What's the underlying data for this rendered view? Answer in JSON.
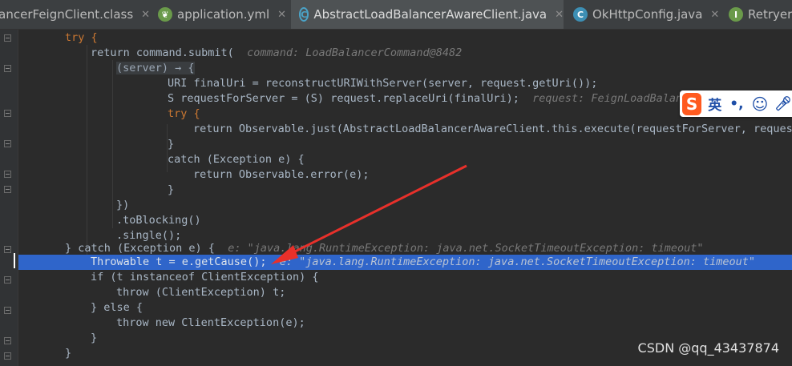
{
  "tabs": [
    {
      "label": "lancerFeignClient.class",
      "icon": "class-file-icon",
      "active": false
    },
    {
      "label": "application.yml",
      "icon": "spring-leaf-icon",
      "active": false
    },
    {
      "label": "AbstractLoadBalancerAwareClient.java",
      "icon": "abstract-class-icon",
      "active": true
    },
    {
      "label": "OkHttpConfig.java",
      "icon": "class-icon",
      "active": false
    },
    {
      "label": "Retryer",
      "icon": "interface-icon",
      "active": false
    }
  ],
  "code_lines": [
    [
      "try {"
    ],
    [
      "return command.submit(",
      "command: LoadBalancerCommand@8482"
    ],
    [
      "(server) → {"
    ],
    [
      "URI finalUri = reconstructURIWithServer(server, request.getUri());"
    ],
    [
      "S requestForServer = (S) request.replaceUri(finalUri);",
      "request: FeignLoadBalanc"
    ],
    [
      "try {"
    ],
    [
      "return Observable.just(AbstractLoadBalancerAwareClient.this.execute(requestForServer, request("
    ],
    [
      "}"
    ],
    [
      "catch (Exception e) {"
    ],
    [
      "return Observable.error(e);"
    ],
    [
      "}"
    ],
    [
      "})"
    ],
    [
      ".toBlocking()"
    ],
    [
      ".single();"
    ],
    [
      "} catch (Exception e) {",
      "e: \"java.lang.RuntimeException: java.net.SocketTimeoutException: timeout\""
    ],
    [
      "Throwable t = e.getCause();",
      "e: \"java.lang.RuntimeException: java.net.SocketTimeoutException: timeout\""
    ],
    [
      "if (t instanceof ClientException) {"
    ],
    [
      "throw (ClientException) t;"
    ],
    [
      "} else {"
    ],
    [
      "throw new ClientException(e);"
    ],
    [
      "}"
    ],
    [
      "}"
    ]
  ],
  "ime": {
    "logo": "S",
    "lang": "英",
    "punct": "•,",
    "emoji_icon": "smiley-icon",
    "mic_icon": "microphone-icon"
  },
  "watermark": "CSDN @qq_43437874",
  "colors": {
    "keyword": "#cc7832",
    "method": "#ffc66d",
    "highlight": "#2f65ca",
    "arrow": "#e8302a",
    "background": "#2b2b2b"
  }
}
